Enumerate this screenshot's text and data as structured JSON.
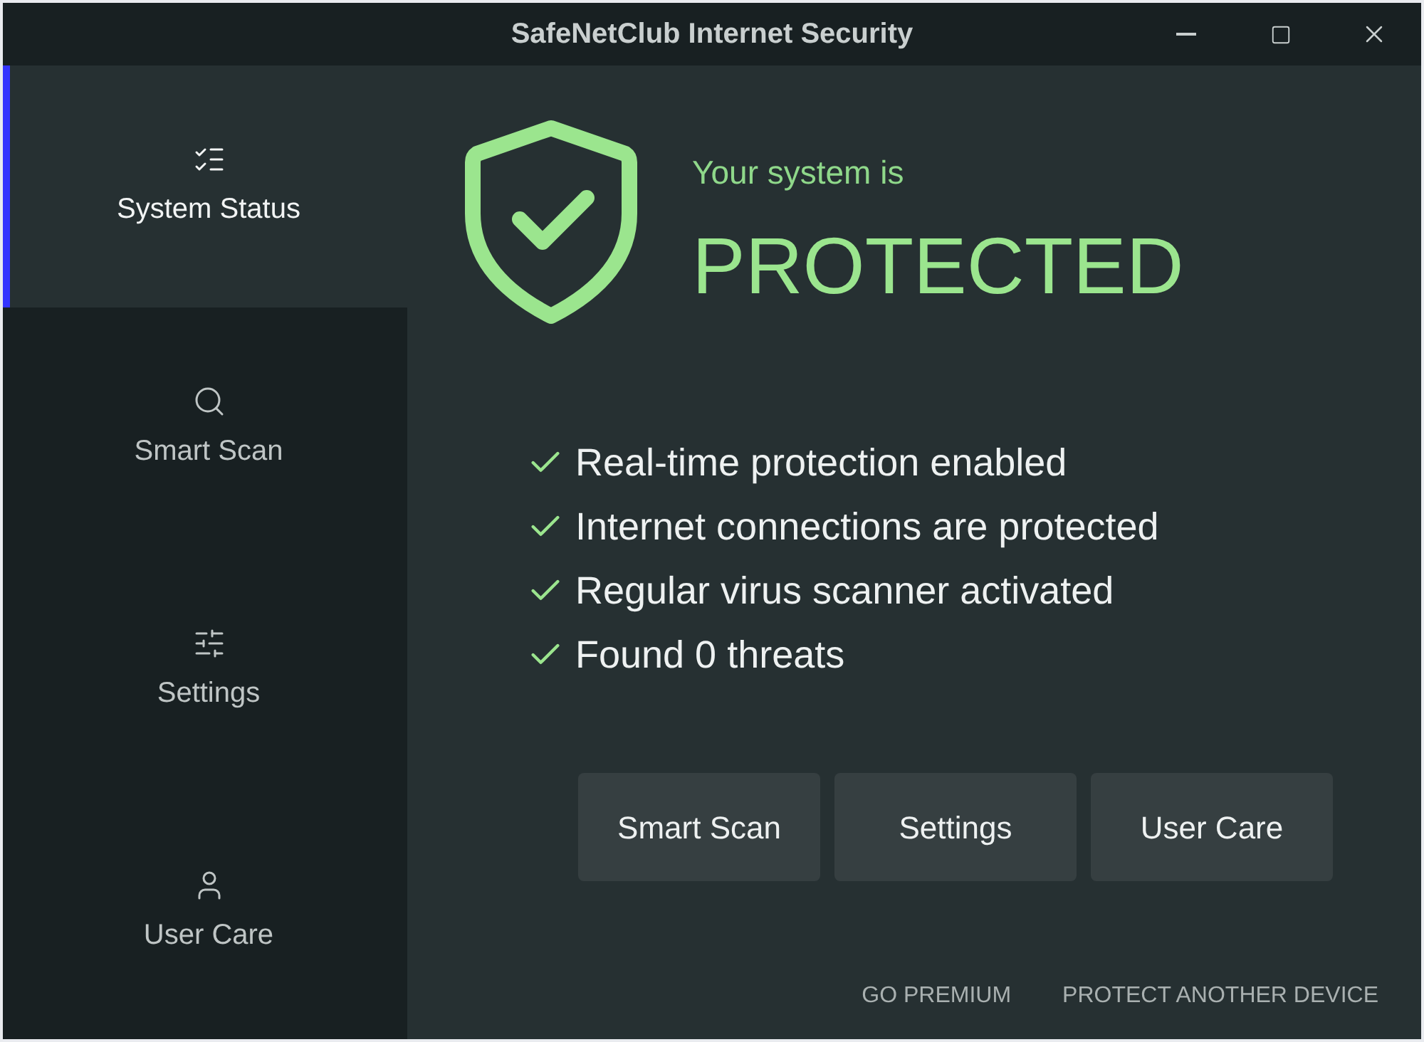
{
  "window": {
    "title": "SafeNetClub Internet Security"
  },
  "sidebar": {
    "items": [
      {
        "kind": "status",
        "label": "System Status",
        "selected": true
      },
      {
        "kind": "search",
        "label": "Smart Scan",
        "selected": false
      },
      {
        "kind": "settings",
        "label": "Settings",
        "selected": false
      },
      {
        "kind": "user",
        "label": "User Care",
        "selected": false
      }
    ]
  },
  "status": {
    "intro": "Your system is",
    "headline": "PROTECTED"
  },
  "checks": [
    "Real-time protection enabled",
    "Internet connections are protected",
    "Regular virus scanner activated",
    "Found 0 threats"
  ],
  "buttons": [
    "Smart Scan",
    "Settings",
    "User Care"
  ],
  "footer_links": [
    "GO PREMIUM",
    "PROTECT ANOTHER DEVICE"
  ]
}
